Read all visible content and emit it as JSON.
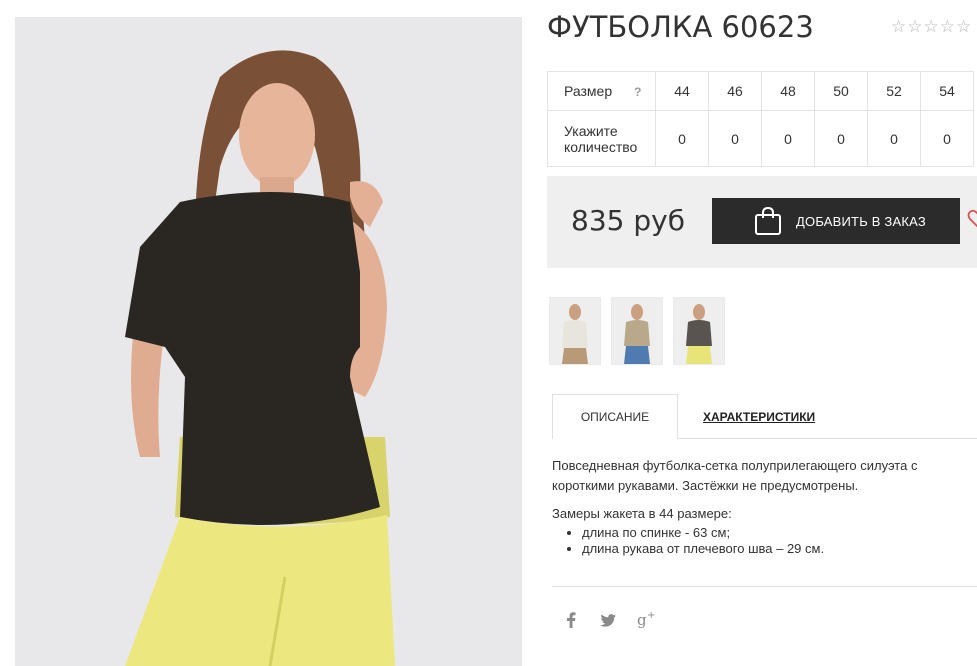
{
  "product": {
    "title": "ФУТБОЛКА 60623",
    "rating": {
      "value": 0,
      "max": 5
    },
    "price": "835 руб",
    "add_to_order_label": "ДОБАВИТЬ В ЗАКАЗ"
  },
  "size_table": {
    "size_label": "Размер",
    "help_symbol": "?",
    "sizes": [
      "44",
      "46",
      "48",
      "50",
      "52",
      "54"
    ],
    "quantity_label_line1": "Укажите",
    "quantity_label_line2": "количество",
    "quantities": [
      "0",
      "0",
      "0",
      "0",
      "0",
      "0"
    ]
  },
  "tabs": {
    "description": "ОПИСАНИЕ",
    "characteristics": "ХАРАКТЕРИСТИКИ"
  },
  "description": {
    "text": "Повседневная футболка-сетка полуприлегающего силуэта с короткими рукавами. Застёжки не предусмотрены.",
    "measures_title": "Замеры жакета в 44 размере:",
    "measures": [
      "длина по спинке - 63 см;",
      "длина рукава от плечевого шва – 29 см."
    ]
  },
  "social": [
    "f",
    "twitter",
    "g+"
  ],
  "colors": {
    "button_bg": "#2b2b2b",
    "price_box_bg": "#efefef",
    "wishlist_accent": "#d9534f"
  },
  "icons": [
    "bag-icon",
    "heart-icon",
    "star-icon",
    "facebook-icon",
    "twitter-icon",
    "google-plus-icon"
  ]
}
